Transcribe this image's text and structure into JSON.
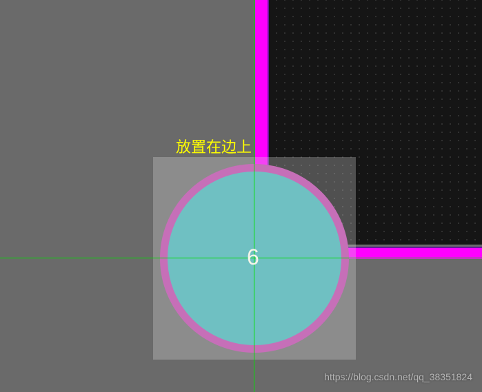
{
  "annotation": {
    "text": "放置在边上"
  },
  "component": {
    "pin_number": "6"
  },
  "watermark": {
    "text": "https://blog.csdn.net/qq_38351824"
  },
  "colors": {
    "background": "#6a6a6a",
    "board_fill": "#151515",
    "board_outline": "#ff00ff",
    "silkscreen_ring": "#c66fb8",
    "pad_fill": "#6fc0c2",
    "crosshair": "#00e000",
    "annotation": "#ffff00",
    "pin_label": "#f5f5e8"
  }
}
